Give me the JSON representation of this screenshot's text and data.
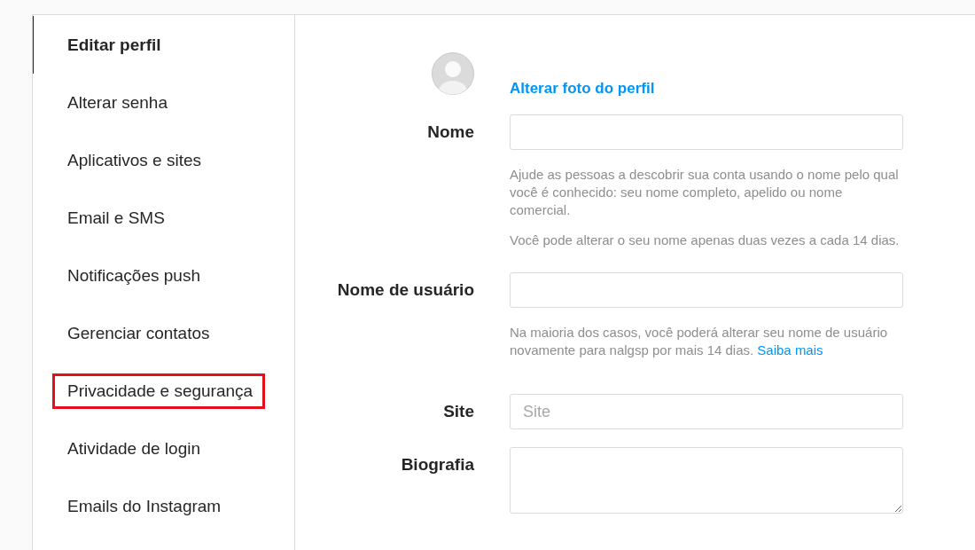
{
  "sidebar": {
    "items": [
      {
        "label": "Editar perfil",
        "selected": true,
        "highlighted": false
      },
      {
        "label": "Alterar senha",
        "selected": false,
        "highlighted": false
      },
      {
        "label": "Aplicativos e sites",
        "selected": false,
        "highlighted": false
      },
      {
        "label": "Email e SMS",
        "selected": false,
        "highlighted": false
      },
      {
        "label": "Notificações push",
        "selected": false,
        "highlighted": false
      },
      {
        "label": "Gerenciar contatos",
        "selected": false,
        "highlighted": false
      },
      {
        "label": "Privacidade e segurança",
        "selected": false,
        "highlighted": true
      },
      {
        "label": "Atividade de login",
        "selected": false,
        "highlighted": false
      },
      {
        "label": "Emails do Instagram",
        "selected": false,
        "highlighted": false
      }
    ]
  },
  "profile": {
    "change_photo_link": "Alterar foto do perfil"
  },
  "form": {
    "fields": [
      {
        "kind": "input",
        "label": "Nome",
        "help": [
          {
            "text": "Ajude as pessoas a descobrir sua conta usando o nome pelo qual você é conhecido: seu nome completo, apelido ou nome comercial."
          },
          {
            "text": "Você pode alterar o seu nome apenas duas vezes a cada 14 dias."
          }
        ]
      },
      {
        "kind": "input",
        "label": "Nome de usuário",
        "help": [
          {
            "text": "Na maioria dos casos, você poderá alterar seu nome de usuário novamente para nalgsp por mais 14 dias.",
            "link": "Saiba mais"
          }
        ]
      },
      {
        "kind": "input",
        "label": "Site",
        "placeholder": "Site"
      },
      {
        "kind": "textarea",
        "label": "Biografia"
      }
    ]
  }
}
